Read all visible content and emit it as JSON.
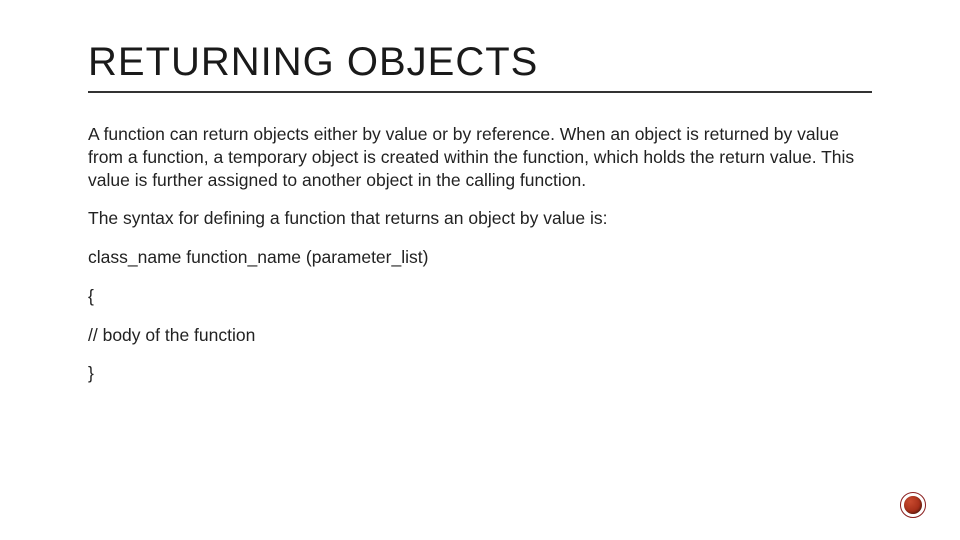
{
  "title": "RETURNING OBJECTS",
  "paragraphs": {
    "p1": "A function can return objects either by value or by reference. When an object is returned by value from a function, a temporary object is created within the function, which holds the return value. This value is further assigned to another object in the calling function.",
    "p2": "The syntax for defining a function that returns an object by value is:",
    "s1": "class_name function_name (parameter_list)",
    "s2": "{",
    "s3": "// body of the function",
    "s4": "}"
  },
  "decor": {
    "bullet_name": "decorative-bullet-icon"
  }
}
